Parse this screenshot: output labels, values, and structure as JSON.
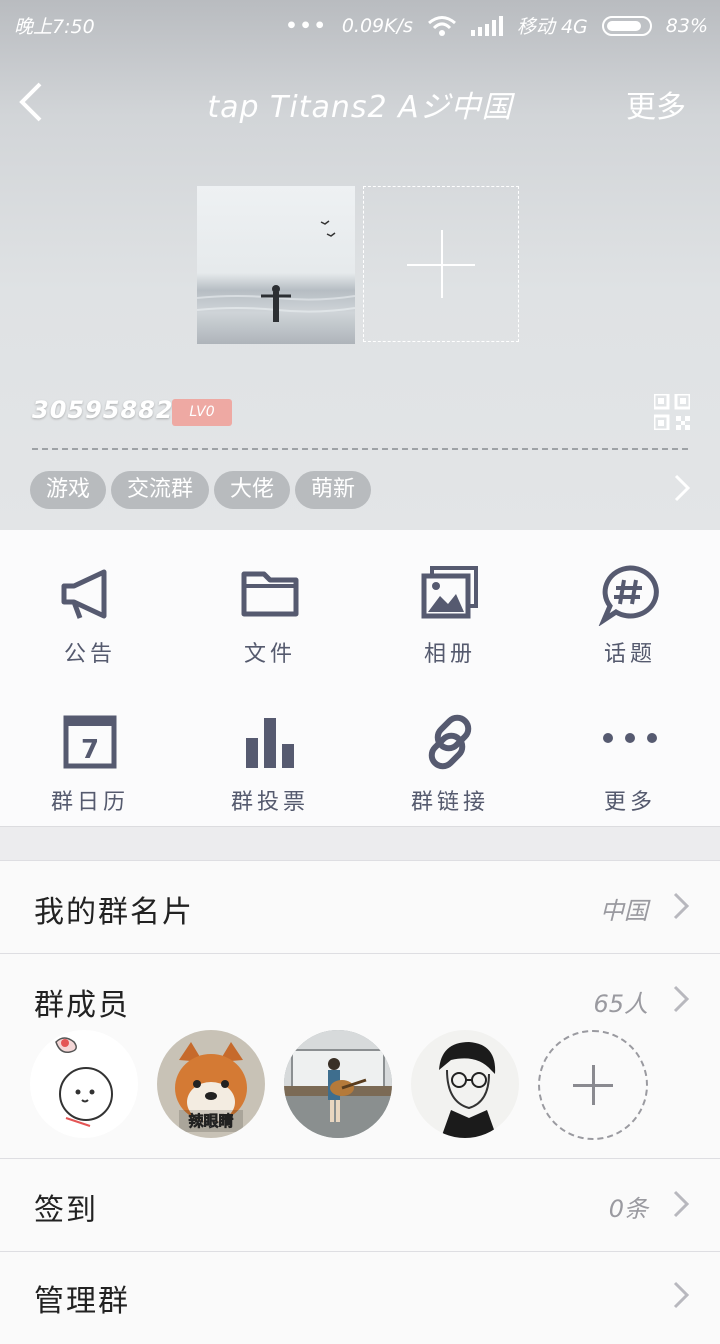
{
  "status": {
    "time": "晚上7:50",
    "dots": "•••",
    "speed": "0.09K/s",
    "carrier": "移动 4G",
    "battery": "83%"
  },
  "nav": {
    "title": "tap Titans2 Aジ中国",
    "more": "更多"
  },
  "group": {
    "id": "305958828",
    "level": "LV0",
    "tags": [
      "游戏",
      "交流群",
      "大佬",
      "萌新"
    ]
  },
  "features": [
    {
      "label": "公告",
      "icon": "megaphone-icon"
    },
    {
      "label": "文件",
      "icon": "folder-icon"
    },
    {
      "label": "相册",
      "icon": "photo-album-icon"
    },
    {
      "label": "话题",
      "icon": "topic-icon"
    },
    {
      "label": "群日历",
      "icon": "calendar-icon",
      "icon_text": "7"
    },
    {
      "label": "群投票",
      "icon": "bar-chart-icon"
    },
    {
      "label": "群链接",
      "icon": "link-icon"
    },
    {
      "label": "更多",
      "icon": "more-dots-icon"
    }
  ],
  "list": {
    "card": {
      "label": "我的群名片",
      "value": "中国"
    },
    "members": {
      "label": "群成员",
      "value": "65人",
      "avatar2_caption": "辣眼睛"
    },
    "checkin": {
      "label": "签到",
      "value": "0条"
    },
    "partial": {
      "label": "管理群"
    }
  },
  "colors": {
    "icon": "#565a70",
    "level_badge": "#eea9a3",
    "tag": "#b8bbbe"
  }
}
